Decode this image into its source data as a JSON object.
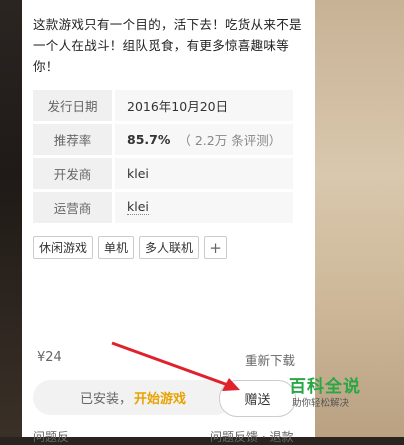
{
  "description": "这款游戏只有一个目的，活下去！吃货从来不是一个人在战斗！组队觅食，有更多惊喜趣味等你！",
  "info": {
    "release_label": "发行日期",
    "release_value": "2016年10月20日",
    "rating_label": "推荐率",
    "rating_value": "85.7%",
    "rating_note": "（ 2.2万 条评测）",
    "developer_label": "开发商",
    "developer_value": "klei",
    "publisher_label": "运营商",
    "publisher_value": "klei"
  },
  "tags": [
    "休闲游戏",
    "单机",
    "多人联机"
  ],
  "tag_add": "+",
  "price": "¥24",
  "redownload": "重新下载",
  "status": {
    "installed": "已安装，",
    "play": "开始游戏"
  },
  "gift": "赠送",
  "bottom": {
    "left": "问题反",
    "right": "问题反馈 · 退款"
  },
  "watermark": {
    "title": "百科全说",
    "subtitle": "助你轻松解决"
  },
  "colors": {
    "accent": "#e8a300",
    "arrow": "#e0202a",
    "watermark": "#27a844"
  }
}
